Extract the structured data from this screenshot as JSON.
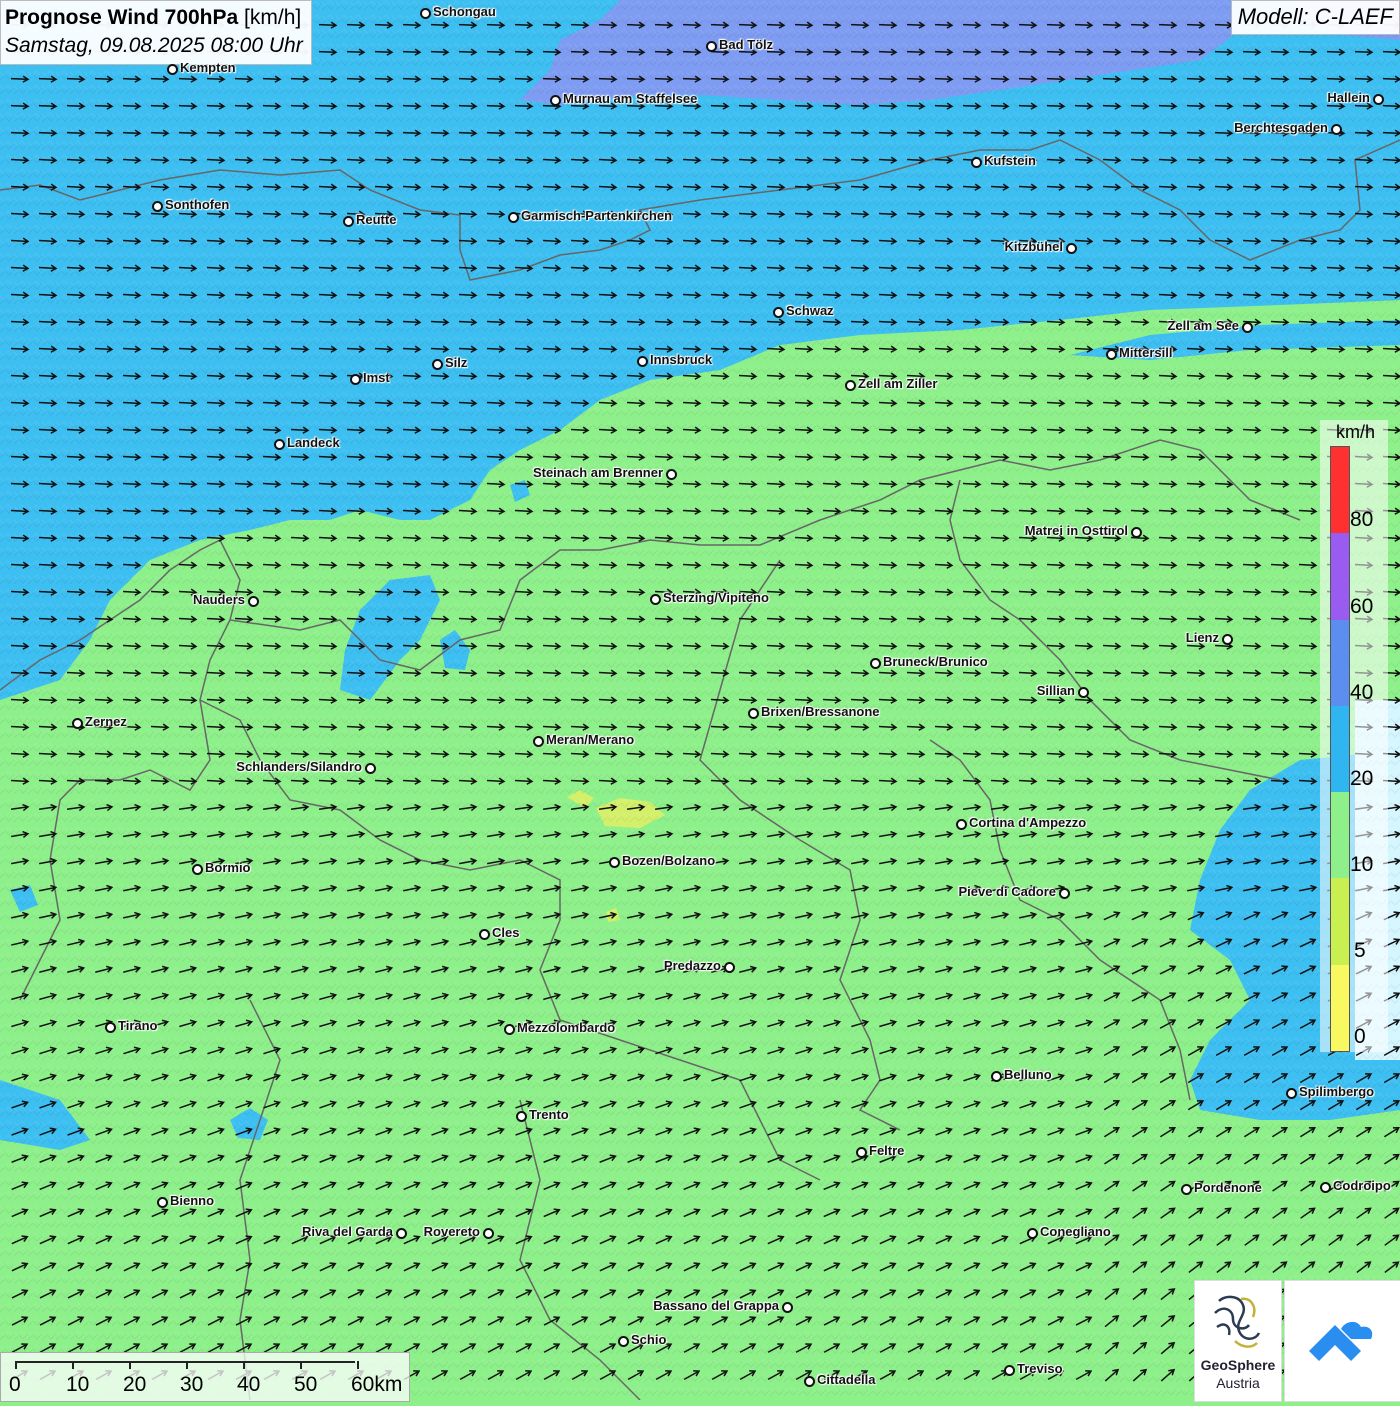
{
  "header": {
    "title_bold": "Prognose Wind 700hPa",
    "title_unit": "[km/h]",
    "datetime": "Samstag, 09.08.2025 08:00 Uhr",
    "model": "Modell: C-LAEF"
  },
  "cities": [
    {
      "name": "Schongau",
      "label_side": "right"
    },
    {
      "name": "Bad Tölz",
      "label_side": "right"
    },
    {
      "name": "Kempten",
      "label_side": "right"
    },
    {
      "name": "Murnau am Staffelsee",
      "label_side": "right"
    },
    {
      "name": "Hallein",
      "label_side": "left"
    },
    {
      "name": "Berchtesgaden",
      "label_side": "left"
    },
    {
      "name": "Kufstein",
      "label_side": "right"
    },
    {
      "name": "Sonthofen",
      "label_side": "right"
    },
    {
      "name": "Reutte",
      "label_side": "right"
    },
    {
      "name": "Garmisch-Partenkirchen",
      "label_side": "right"
    },
    {
      "name": "Kitzbühel",
      "label_side": "left"
    },
    {
      "name": "Schwaz",
      "label_side": "right"
    },
    {
      "name": "Zell am See",
      "label_side": "left"
    },
    {
      "name": "Mittersill",
      "label_side": "right"
    },
    {
      "name": "Innsbruck",
      "label_side": "right"
    },
    {
      "name": "Silz",
      "label_side": "right"
    },
    {
      "name": "Imst",
      "label_side": "right"
    },
    {
      "name": "Zell am Ziller",
      "label_side": "right"
    },
    {
      "name": "Landeck",
      "label_side": "right"
    },
    {
      "name": "Steinach am Brenner",
      "label_side": "left"
    },
    {
      "name": "Matrei in Osttirol",
      "label_side": "left"
    },
    {
      "name": "Nauders",
      "label_side": "left"
    },
    {
      "name": "Sterzing/Vipiteno",
      "label_side": "right"
    },
    {
      "name": "Lienz",
      "label_side": "left"
    },
    {
      "name": "Bruneck/Brunico",
      "label_side": "right"
    },
    {
      "name": "Sillian",
      "label_side": "left"
    },
    {
      "name": "Brixen/Bressanone",
      "label_side": "right"
    },
    {
      "name": "Zernez",
      "label_side": "right"
    },
    {
      "name": "Meran/Merano",
      "label_side": "right"
    },
    {
      "name": "Schlanders/Silandro",
      "label_side": "left"
    },
    {
      "name": "Cortina d'Ampezzo",
      "label_side": "right"
    },
    {
      "name": "Bozen/Bolzano",
      "label_side": "right"
    },
    {
      "name": "Bormio",
      "label_side": "right"
    },
    {
      "name": "Pieve di Cadore",
      "label_side": "left"
    },
    {
      "name": "Cles",
      "label_side": "right"
    },
    {
      "name": "Predazzo",
      "label_side": "left"
    },
    {
      "name": "Tirano",
      "label_side": "right"
    },
    {
      "name": "Mezzolombardo",
      "label_side": "right"
    },
    {
      "name": "Belluno",
      "label_side": "right"
    },
    {
      "name": "Spilimbergo",
      "label_side": "right"
    },
    {
      "name": "Trento",
      "label_side": "right"
    },
    {
      "name": "Feltre",
      "label_side": "right"
    },
    {
      "name": "Pordenone",
      "label_side": "right"
    },
    {
      "name": "Codroipo",
      "label_side": "right"
    },
    {
      "name": "Bienno",
      "label_side": "right"
    },
    {
      "name": "Riva del Garda",
      "label_side": "left"
    },
    {
      "name": "Rovereto",
      "label_side": "left"
    },
    {
      "name": "Conegliano",
      "label_side": "right"
    },
    {
      "name": "Bassano del Grappa",
      "label_side": "left"
    },
    {
      "name": "Schio",
      "label_side": "right"
    },
    {
      "name": "Treviso",
      "label_side": "right"
    },
    {
      "name": "Cittadella",
      "label_side": "right"
    }
  ],
  "legend": {
    "unit": "km/h",
    "ticks": [
      "80",
      "60",
      "40",
      "20",
      "10",
      "5",
      "0"
    ],
    "colors": [
      "#ff3030",
      "#9a5cf0",
      "#5c8ef0",
      "#2fb6f0",
      "#8ef08a",
      "#c8f050",
      "#f8f860"
    ]
  },
  "scalebar": {
    "labels": [
      "0",
      "10",
      "20",
      "30",
      "40",
      "50",
      "60km"
    ]
  },
  "logos": {
    "geosphere_line1": "GeoSphere",
    "geosphere_line2": "Austria"
  },
  "colors": {
    "wind_lt10": "#8ef08a",
    "wind_10_20": "#3dbff2",
    "wind_20_40": "#7e9cf2",
    "wind_5_10": "#d4f06a",
    "wind_0_5": "#f4f470",
    "border": "#666666"
  }
}
